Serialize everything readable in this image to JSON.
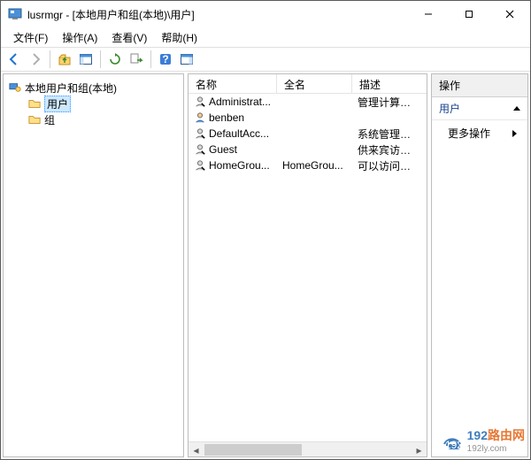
{
  "title": "lusrmgr - [本地用户和组(本地)\\用户]",
  "menus": {
    "file": "文件(F)",
    "action": "操作(A)",
    "view": "查看(V)",
    "help": "帮助(H)"
  },
  "tree": {
    "root": "本地用户和组(本地)",
    "users": "用户",
    "groups": "组"
  },
  "columns": {
    "name": "名称",
    "fullname": "全名",
    "desc": "描述"
  },
  "users": [
    {
      "name": "Administrat...",
      "fullname": "",
      "desc": "管理计算机(域)的"
    },
    {
      "name": "benben",
      "fullname": "",
      "desc": ""
    },
    {
      "name": "DefaultAcc...",
      "fullname": "",
      "desc": "系统管理的用户帐"
    },
    {
      "name": "Guest",
      "fullname": "",
      "desc": "供来宾访问计算机"
    },
    {
      "name": "HomeGrou...",
      "fullname": "HomeGrou...",
      "desc": "可以访问计算机的"
    }
  ],
  "actions": {
    "header": "操作",
    "section": "用户",
    "more": "更多操作"
  },
  "watermark": {
    "a": "192",
    "b": "路由网",
    "sub": "192ly.com"
  }
}
